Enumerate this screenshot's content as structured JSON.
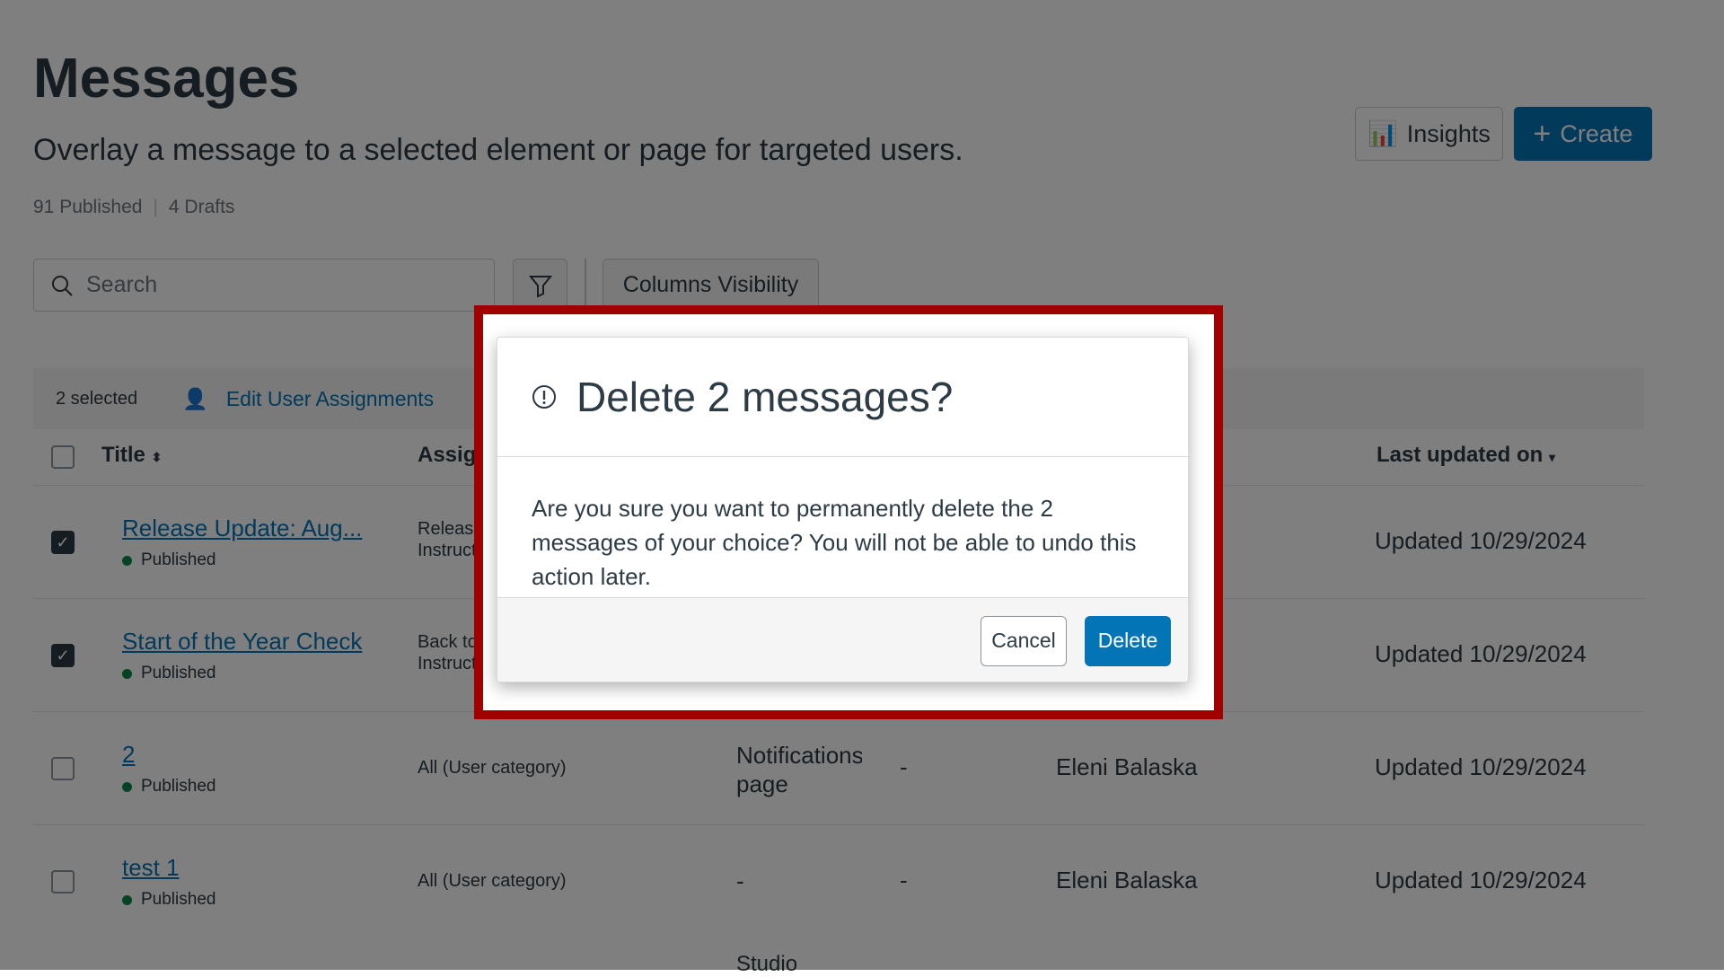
{
  "header": {
    "title": "Messages",
    "subtitle": "Overlay a message to a selected element or page for targeted users.",
    "published": "91 Published",
    "drafts": "4 Drafts",
    "insights": "Insights",
    "create": "Create"
  },
  "toolbar": {
    "search_placeholder": "Search",
    "columns_visibility": "Columns Visibility"
  },
  "selection": {
    "count": "2 selected",
    "edit_assignments": "Edit User Assignments"
  },
  "table": {
    "headers": {
      "title": "Title",
      "assigned": "Assig",
      "last_updated": "Last updated on"
    },
    "rows": [
      {
        "title": "Release Update: Aug...",
        "status": "Published",
        "assigned": "Release of",
        "assigned2": "Instructors",
        "col3": "",
        "col3b": "",
        "col4": "",
        "author": "",
        "updated": "Updated 10/29/2024",
        "checked": true
      },
      {
        "title": "Start of the Year Check",
        "status": "Published",
        "assigned": "Back to Sc",
        "assigned2": "Instructors",
        "col3": "",
        "col3b": "",
        "col4": "",
        "author": "",
        "updated": "Updated 10/29/2024",
        "checked": true
      },
      {
        "title": "2",
        "status": "Published",
        "assigned": "All (User category)",
        "assigned2": "",
        "col3": "Notifications",
        "col3b": "page",
        "col4": "-",
        "author": "Eleni Balaska",
        "updated": "Updated 10/29/2024",
        "checked": false
      },
      {
        "title": "test 1",
        "status": "Published",
        "assigned": "All (User category)",
        "assigned2": "",
        "col3": "-",
        "col3b": "",
        "col4": "-",
        "author": "Eleni Balaska",
        "updated": "Updated 10/29/2024",
        "checked": false
      }
    ],
    "partial_row": {
      "col3": "Studio"
    }
  },
  "dialog": {
    "title": "Delete 2 messages?",
    "body": "Are you sure you want to permanently delete the 2 messages of your choice? You will not be able to undo this action later.",
    "cancel": "Cancel",
    "delete": "Delete"
  },
  "colors": {
    "brand": "#0374B5",
    "highlight": "#A00000",
    "published": "#0B874B"
  }
}
